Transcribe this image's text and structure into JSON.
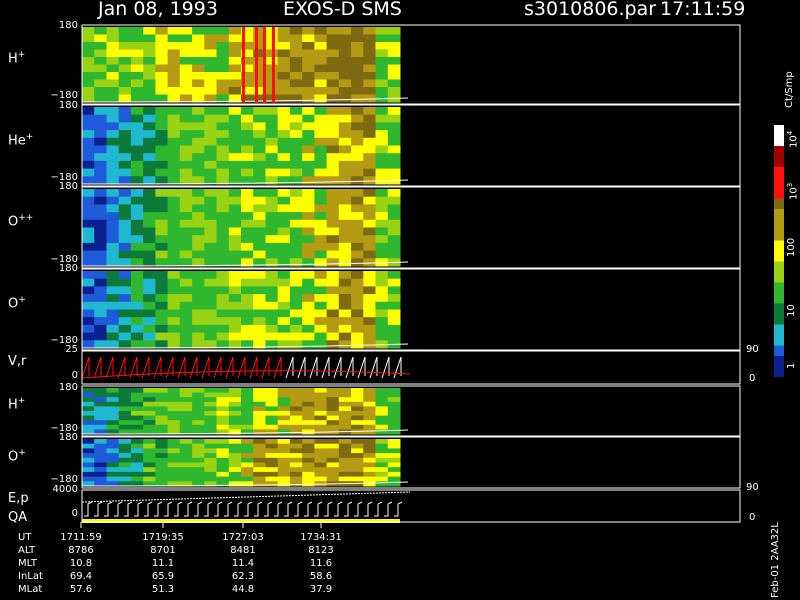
{
  "header": {
    "date": "Jan 08, 1993",
    "instrument": "EXOS-D SMS",
    "file": "s3010806.par",
    "time": "17:11:59"
  },
  "panels": [
    {
      "id": "h",
      "label_base": "H",
      "label_sup": "+",
      "top_tick": "180",
      "bottom_tick": "−180"
    },
    {
      "id": "he",
      "label_base": "He",
      "label_sup": "+",
      "top_tick": "180",
      "bottom_tick": "−180"
    },
    {
      "id": "opp",
      "label_base": "O",
      "label_sup": "++",
      "top_tick": "180",
      "bottom_tick": "−180"
    },
    {
      "id": "o",
      "label_base": "O",
      "label_sup": "+",
      "top_tick": "180",
      "bottom_tick": "−180"
    },
    {
      "id": "vr",
      "label_base": "V,r",
      "label_sup": "",
      "top_tick": "25",
      "bottom_tick": "0",
      "right_top": "90",
      "right_bottom": "0"
    },
    {
      "id": "h2",
      "label_base": "H",
      "label_sup": "+",
      "top_tick": "180",
      "bottom_tick": "−180"
    },
    {
      "id": "o2",
      "label_base": "O",
      "label_sup": "+",
      "top_tick": "180",
      "bottom_tick": "−180"
    },
    {
      "id": "ep",
      "label_base": "E,p",
      "label_sup": "",
      "label2": "QA",
      "top_tick": "4000",
      "bottom_tick": "0",
      "right_top": "90",
      "right_bottom": "0"
    }
  ],
  "colorbar": {
    "unit": "Ct/Smp",
    "tick_1e4_base": "10",
    "tick_1e4_exp": "4",
    "tick_1e3_base": "10",
    "tick_1e3_exp": "3",
    "tick_100": "100",
    "tick_10": "10",
    "tick_1": "1"
  },
  "footer": {
    "row_labels": [
      "UT",
      "ALT",
      "MLT",
      "InLat",
      "MLat"
    ],
    "columns": [
      [
        "1711:59",
        "8786",
        "10.8",
        "69.4",
        "57.6"
      ],
      [
        "1719:35",
        "8701",
        "11.1",
        "65.9",
        "51.3"
      ],
      [
        "1727:03",
        "8481",
        "11.4",
        "62.3",
        "44.8"
      ],
      [
        "1734:31",
        "8123",
        "11.6",
        "58.6",
        "37.9"
      ]
    ],
    "side_note": "Feb-01 2AA32L"
  },
  "colors": {
    "dark_blue": "#0b1f8f",
    "blue": "#1f5bd8",
    "cyan": "#20b8d0",
    "dark_green": "#0d7a3a",
    "green": "#2fb82f",
    "lime": "#9ad214",
    "yellow": "#ffff00",
    "olive": "#b59a14",
    "dark_olive": "#7e6a10",
    "red": "#ff1010",
    "dark_red": "#a00000",
    "white": "#ffffff"
  },
  "chart_data": {
    "type": "heatmap",
    "title": "Jan 08, 1993   EXOS-D SMS",
    "x_ticks": [
      "1711:59",
      "1719:35",
      "1727:03",
      "1734:31"
    ],
    "colorbar_label": "Ct/Smp",
    "colorbar_ticks": [
      "1",
      "10",
      "100",
      "10^3",
      "10^4"
    ],
    "series": [
      {
        "name": "H+",
        "ylim": [
          -180,
          180
        ],
        "profile": [
          5,
          6,
          6,
          6,
          6,
          6,
          7,
          7,
          7,
          7,
          7,
          7,
          8,
          8,
          8,
          8,
          8,
          8,
          8,
          8,
          9,
          9,
          9,
          9,
          6,
          6
        ]
      },
      {
        "name": "He+",
        "ylim": [
          -180,
          180
        ],
        "profile": [
          1,
          1,
          2,
          2,
          3,
          3,
          4,
          5,
          5,
          5,
          5,
          5,
          6,
          6,
          6,
          6,
          6,
          6,
          7,
          7,
          8,
          8,
          8,
          8,
          6,
          6
        ]
      },
      {
        "name": "O++",
        "ylim": [
          -180,
          180
        ],
        "profile": [
          1,
          1,
          2,
          2,
          3,
          3,
          4,
          5,
          5,
          5,
          5,
          5,
          6,
          6,
          6,
          6,
          6,
          6,
          7,
          7,
          8,
          8,
          8,
          8,
          6,
          6
        ]
      },
      {
        "name": "O+",
        "ylim": [
          -180,
          180
        ],
        "profile": [
          1,
          1,
          2,
          2,
          3,
          3,
          4,
          5,
          5,
          5,
          5,
          5,
          6,
          6,
          6,
          6,
          6,
          6,
          7,
          7,
          8,
          8,
          8,
          8,
          6,
          6
        ]
      },
      {
        "name": "H+",
        "ylim": [
          -180,
          180
        ],
        "profile": [
          2,
          2,
          3,
          3,
          4,
          4,
          5,
          5,
          5,
          5,
          5,
          6,
          6,
          6,
          7,
          7,
          7,
          8,
          8,
          8,
          8,
          8,
          8,
          8,
          6,
          6
        ]
      },
      {
        "name": "O+",
        "ylim": [
          -180,
          180
        ],
        "profile": [
          1,
          1,
          2,
          3,
          3,
          4,
          4,
          5,
          5,
          5,
          5,
          6,
          6,
          7,
          8,
          8,
          8,
          8,
          8,
          8,
          8,
          8,
          8,
          8,
          6,
          6
        ]
      }
    ]
  }
}
